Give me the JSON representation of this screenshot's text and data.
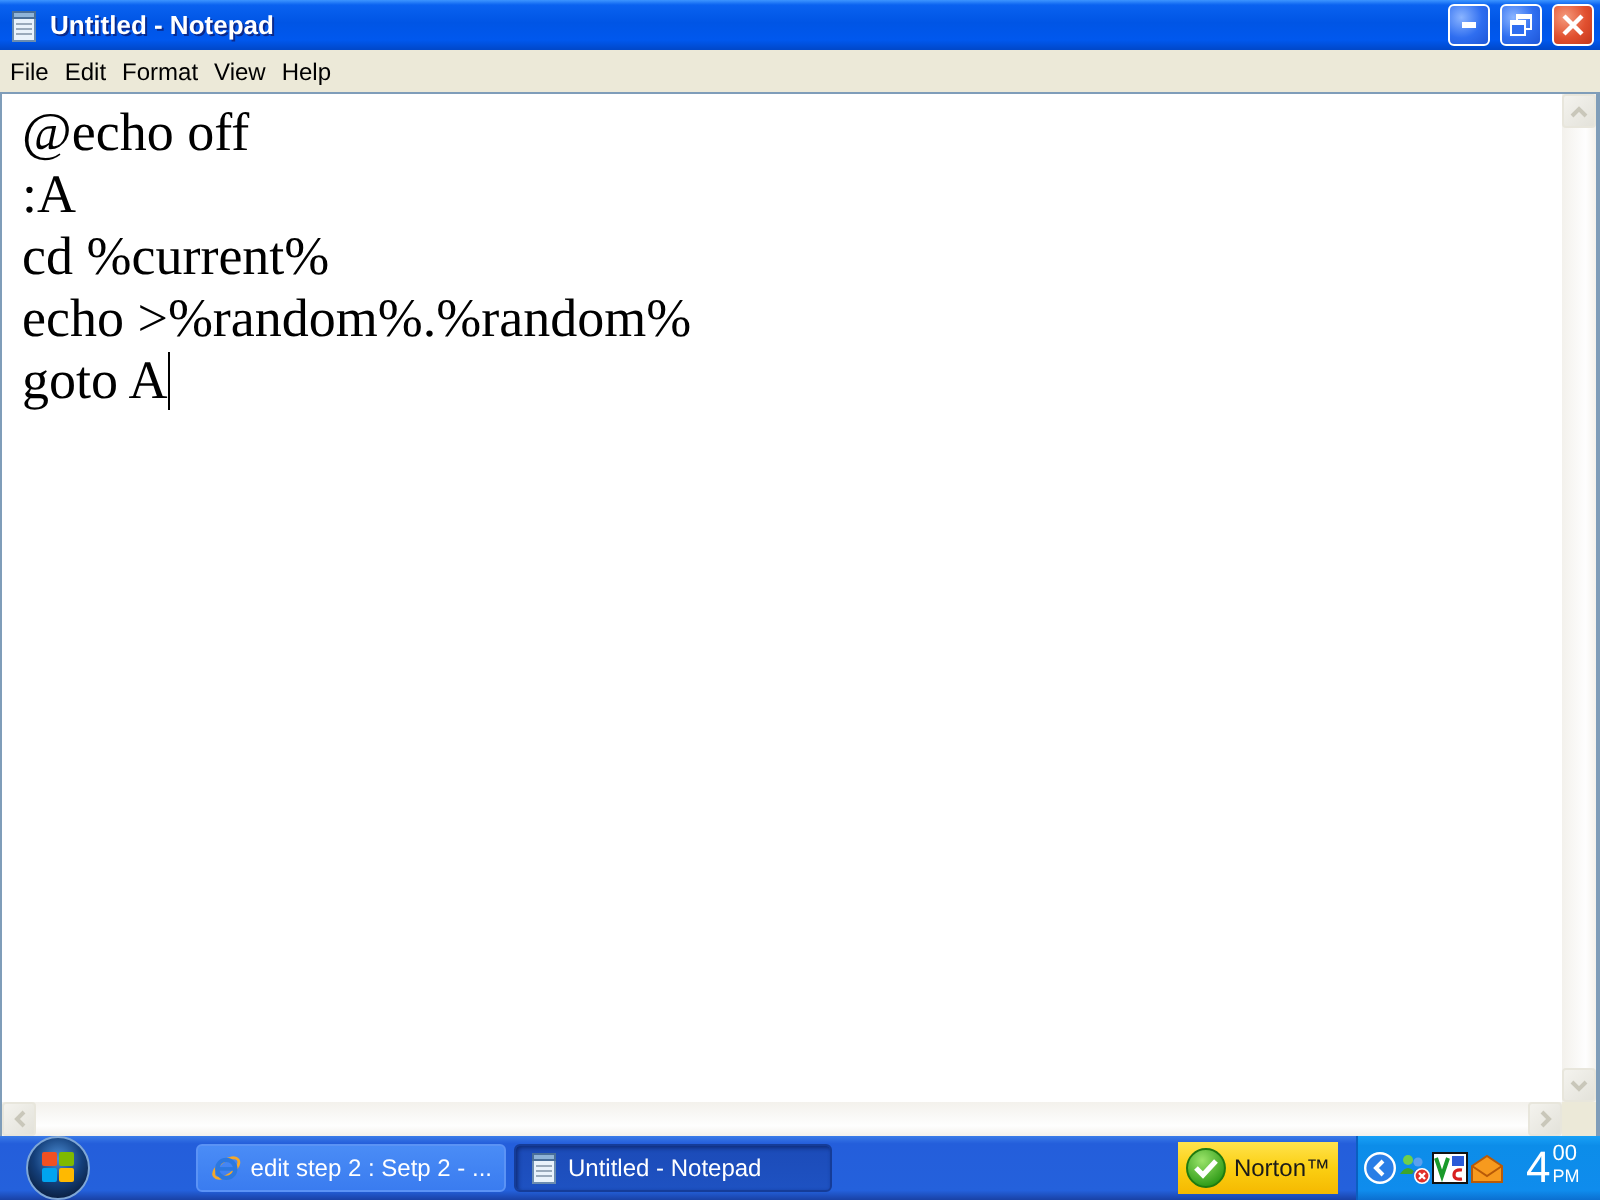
{
  "window": {
    "title": "Untitled - Notepad"
  },
  "menu_bar": {
    "items": [
      "File",
      "Edit",
      "Format",
      "View",
      "Help"
    ]
  },
  "editor": {
    "lines": [
      "@echo off",
      ":A",
      "cd %current%",
      "echo >%random%.%random%",
      "goto A"
    ]
  },
  "taskbar": {
    "tasks": [
      {
        "kind": "browser",
        "label": "edit step 2 : Setp 2 - ...",
        "selected": false
      },
      {
        "kind": "notepad",
        "label": "Untitled - Notepad",
        "selected": true
      }
    ],
    "tray": {
      "norton_label": "Norton™",
      "clock": {
        "hour": "4",
        "minutes": "00",
        "period": "PM"
      }
    }
  }
}
